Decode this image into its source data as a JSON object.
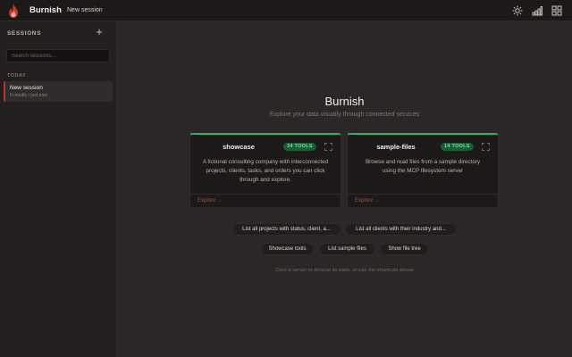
{
  "topbar": {
    "app_name": "Burnish",
    "session_name": "New session",
    "icons": [
      "sun-icon",
      "signal-bars-icon",
      "grid-icon"
    ]
  },
  "sidebar": {
    "title": "SESSIONS",
    "add_label": "+",
    "search": {
      "placeholder": "Search sessions...",
      "value": ""
    },
    "group_label": "TODAY",
    "items": [
      {
        "title": "New session",
        "meta": "0 results • just now"
      }
    ]
  },
  "main": {
    "title": "Burnish",
    "subtitle": "Explore your data visually through connected services",
    "cards": [
      {
        "name": "showcase",
        "badge": "34 TOOLS",
        "description": "A fictional consulting company with interconnected projects, clients, tasks, and orders you can click through and explore.",
        "explore": "Explore →"
      },
      {
        "name": "sample-files",
        "badge": "14 TOOLS",
        "description": "Browse and read files from a sample directory using the MCP filesystem server",
        "explore": "Explore →"
      }
    ],
    "shortcuts": [
      "List all projects with status, client, a...",
      "List all clients with their industry and...",
      "Showcase tools",
      "List sample files",
      "Show file tree"
    ],
    "hint": "Click a server to browse its tools, or use the shortcuts above"
  },
  "colors": {
    "accent_green": "#2fae65",
    "badge_text": "#6fe79b",
    "brand_red": "#b23a3a",
    "explore_link": "#a0514c"
  }
}
